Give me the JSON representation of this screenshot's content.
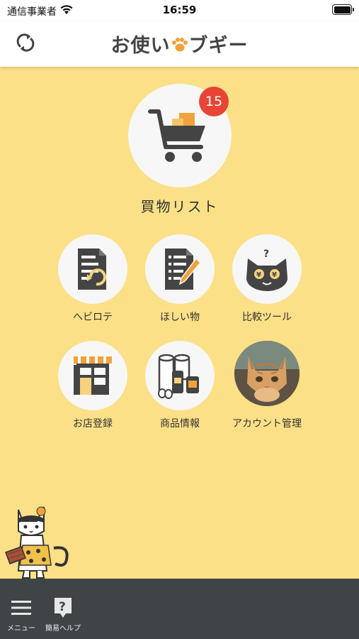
{
  "status": {
    "carrier": "通信事業者",
    "time": "16:59"
  },
  "header": {
    "logo_part1": "お使い",
    "logo_part2": "ブギー"
  },
  "shopping_list": {
    "label": "買物リスト",
    "badge_count": "15"
  },
  "tiles": [
    {
      "label": "へビロテ",
      "icon": "heavy-rotation-icon"
    },
    {
      "label": "ほしい物",
      "icon": "wishlist-icon"
    },
    {
      "label": "比較ツール",
      "icon": "compare-cat-icon"
    },
    {
      "label": "お店登録",
      "icon": "store-icon"
    },
    {
      "label": "商品情報",
      "icon": "groceries-icon"
    },
    {
      "label": "アカウント管理",
      "icon": "avatar-cat-photo"
    }
  ],
  "tabbar": {
    "menu_label": "メニュー",
    "help_label": "簡易ヘルプ"
  },
  "colors": {
    "background": "#fbe087",
    "badge": "#e84536",
    "tabbar": "#3f4447",
    "accent": "#f0a33a"
  }
}
